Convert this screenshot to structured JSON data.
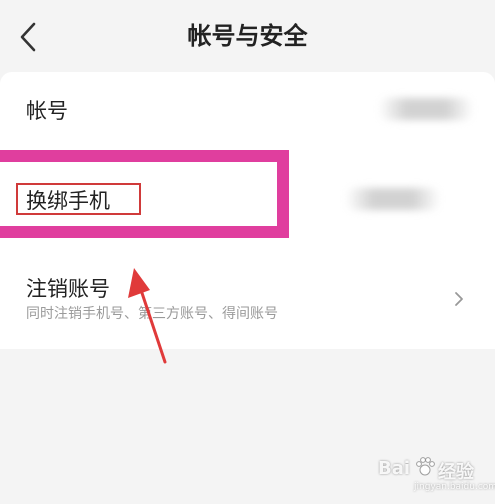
{
  "header": {
    "title": "帐号与安全",
    "back_icon": "chevron-left-icon"
  },
  "rows": {
    "account_label": "帐号",
    "phone_label": "换绑手机",
    "cancel_label": "注销账号",
    "cancel_sub": "同时注销手机号、第三方账号、得间账号",
    "cancel_icon": "chevron-right-icon"
  },
  "annotations": {
    "highlight_color": "#e03e9e",
    "label_box_color": "#d03a3a",
    "arrow_color": "#e03a3a"
  },
  "watermark": {
    "brand": "Bai",
    "product": "经验",
    "url": "jingyan.baidu.com"
  }
}
